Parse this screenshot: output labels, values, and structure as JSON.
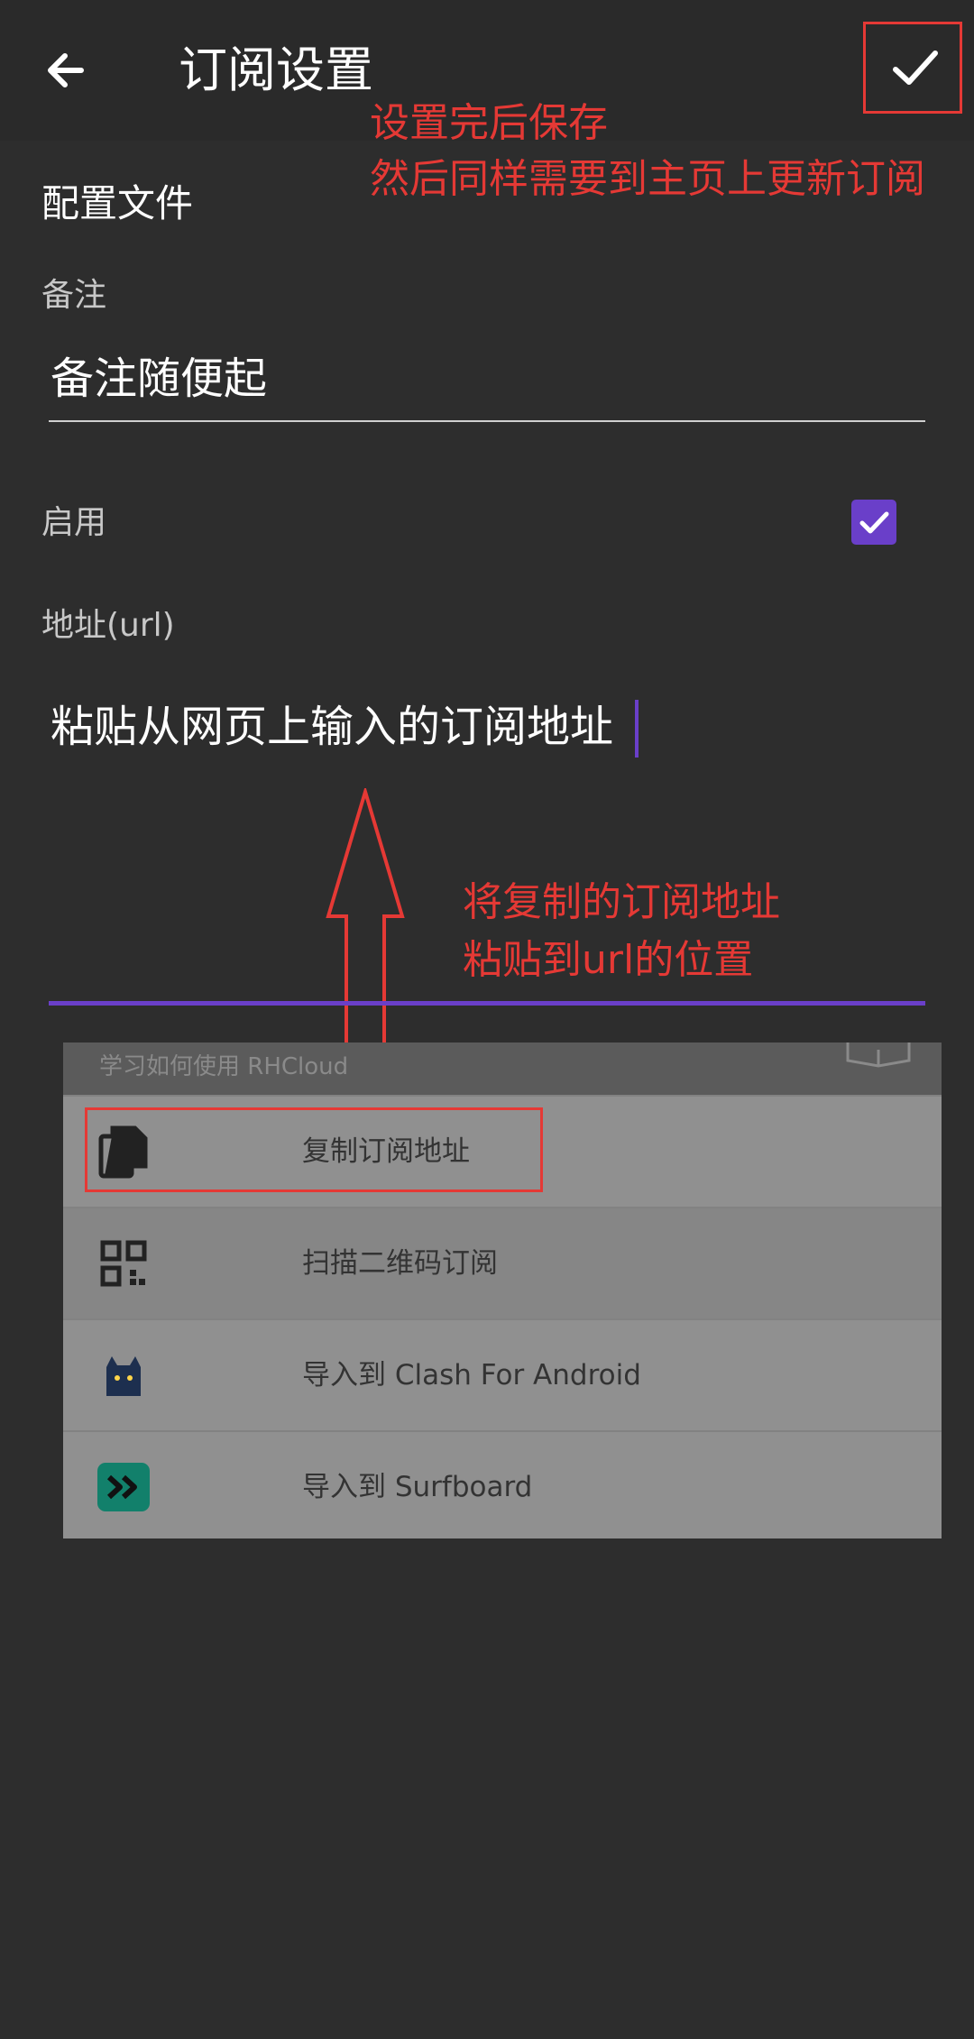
{
  "appbar": {
    "title": "订阅设置",
    "back_icon": "arrow-left-icon",
    "save_icon": "check-icon"
  },
  "annotations": {
    "save_hint_line1": "设置完后保存",
    "save_hint_line2": "然后同样需要到主页上更新订阅",
    "paste_hint_line1": "将复制的订阅地址",
    "paste_hint_line2": "粘贴到url的位置",
    "color": "#e53935"
  },
  "form": {
    "section_title": "配置文件",
    "remark_label": "备注",
    "remark_value": "备注随便起",
    "enable_label": "启用",
    "enable_checked": true,
    "url_label": "地址(url)",
    "url_value": "粘贴从网页上输入的订阅地址",
    "accent_color": "#6a3fc9"
  },
  "popup": {
    "header_text": "学习如何使用 RHCloud",
    "items": [
      {
        "label": "复制订阅地址",
        "icon": "copy-icon"
      },
      {
        "label": "扫描二维码订阅",
        "icon": "qr-code-icon"
      },
      {
        "label": "导入到 Clash For Android",
        "icon": "clash-cat-icon"
      },
      {
        "label": "导入到 Surfboard",
        "icon": "surfboard-icon"
      }
    ]
  }
}
